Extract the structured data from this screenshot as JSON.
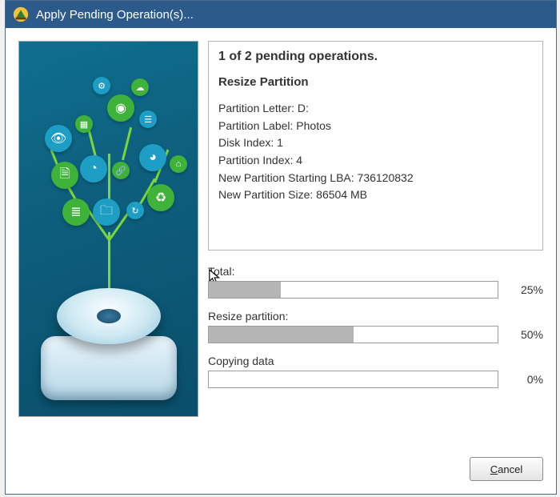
{
  "window": {
    "title": "Apply Pending Operation(s)..."
  },
  "summary": {
    "heading": "1 of 2 pending operations.",
    "operation_title": "Resize Partition",
    "details": {
      "partition_letter": {
        "label": "Partition Letter",
        "value": "D:"
      },
      "partition_label": {
        "label": "Partition Label",
        "value": "Photos"
      },
      "disk_index": {
        "label": "Disk Index",
        "value": "1"
      },
      "partition_index": {
        "label": "Partition Index",
        "value": "4"
      },
      "new_starting_lba": {
        "label": "New Partition Starting LBA",
        "value": "736120832"
      },
      "new_size": {
        "label": "New Partition Size",
        "value": "86504 MB"
      }
    }
  },
  "progress": {
    "total": {
      "label": "Total:",
      "percent": 25,
      "percent_text": "25%"
    },
    "resize": {
      "label": "Resize partition:",
      "percent": 50,
      "percent_text": "50%"
    },
    "copy": {
      "label": "Copying data",
      "percent": 0,
      "percent_text": "0%"
    }
  },
  "buttons": {
    "cancel": "Cancel"
  },
  "illustration_icons": [
    "settings-icon",
    "list-icon",
    "cloud-icon",
    "tag-icon",
    "chart-icon",
    "disc-icon",
    "link-icon",
    "recycle-icon",
    "folder-icon",
    "bars-icon",
    "eye-icon",
    "grid-icon"
  ]
}
